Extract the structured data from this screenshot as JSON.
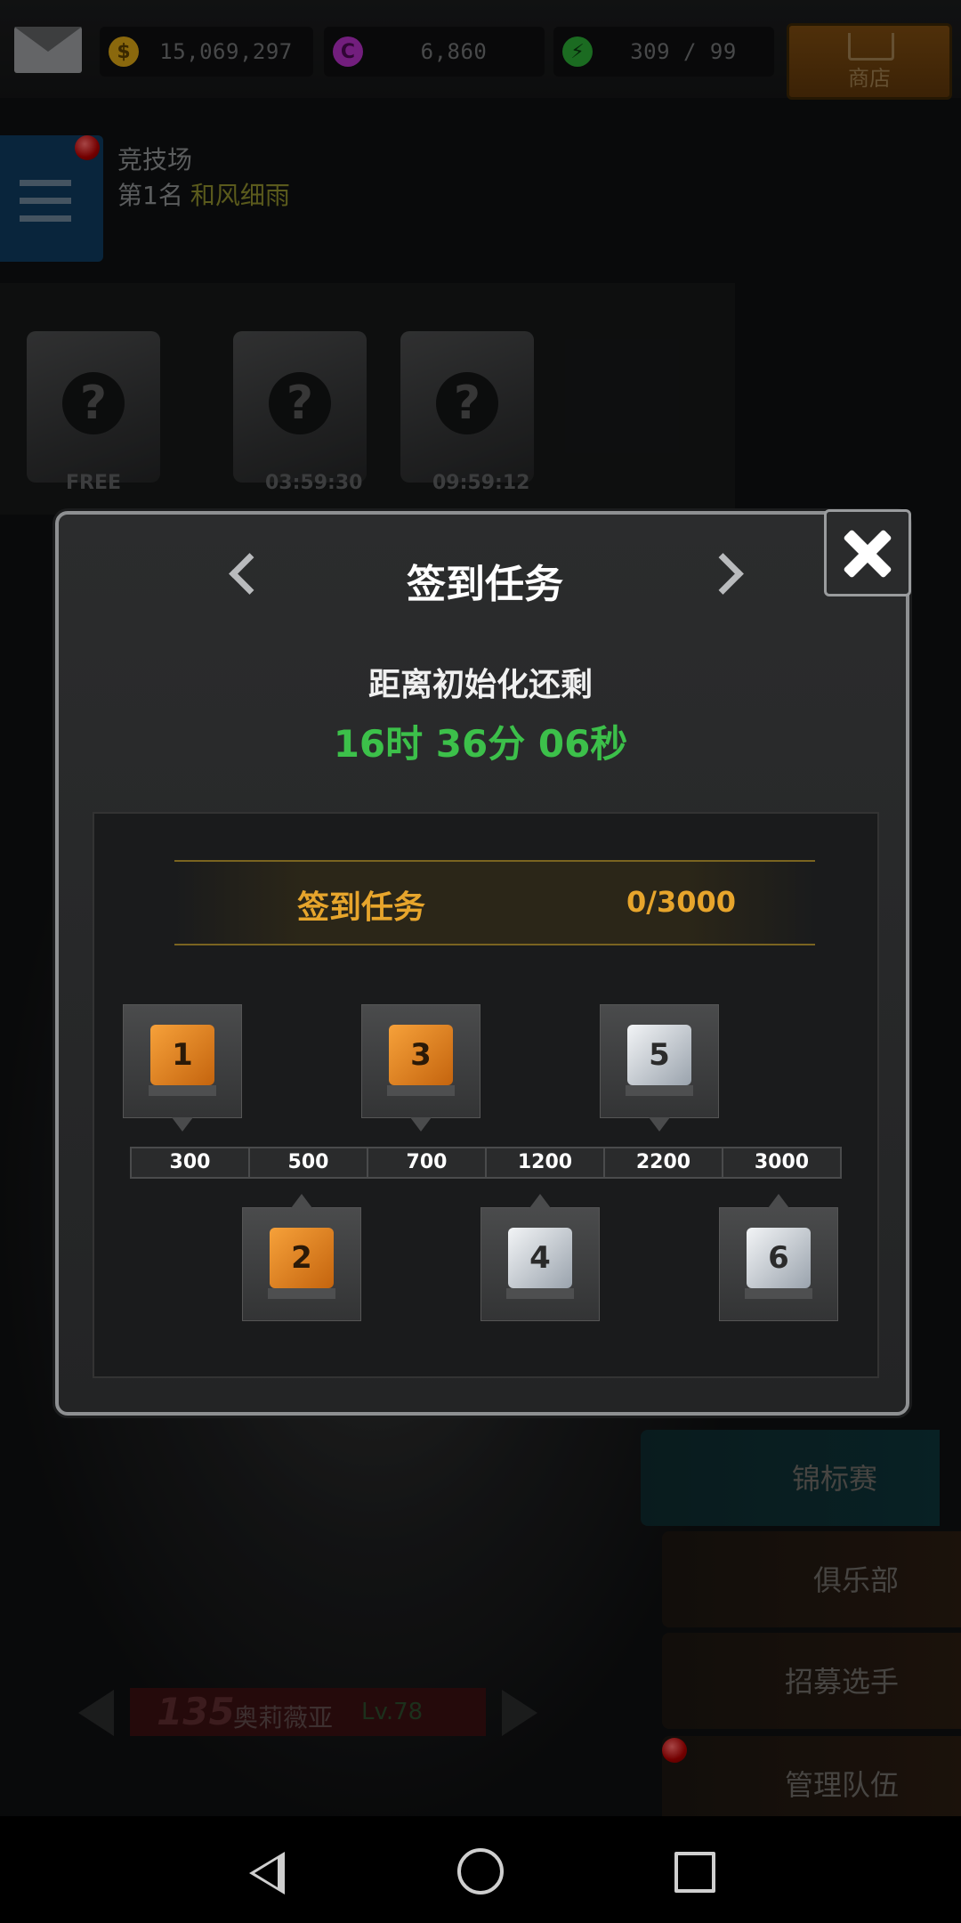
{
  "topbar": {
    "gold": "15,069,297",
    "coins": "6,860",
    "energy": "309 / 99",
    "shop_label": "商店",
    "colors": {
      "gold": "#d4a014",
      "coin": "#b02fc0",
      "energy": "#2aa534"
    }
  },
  "arena": {
    "title": "竞技场",
    "rank_prefix": "第1名",
    "rank_name": "和风细雨"
  },
  "chests": [
    {
      "label": "FREE"
    },
    {
      "label": "03:59:30"
    },
    {
      "label": "09:59:12"
    }
  ],
  "right_menu": [
    {
      "label": "锦标赛"
    },
    {
      "label": "俱乐部"
    },
    {
      "label": "招募选手"
    },
    {
      "label": "管理队伍"
    }
  ],
  "player": {
    "number": "135",
    "name": "奥莉薇亚",
    "level": "Lv.78"
  },
  "dialog": {
    "title": "签到任务",
    "reset_label": "距离初始化还剩",
    "reset_time": "16时 36分 06秒",
    "banner_title": "签到任务",
    "banner_progress": "0/3000",
    "milestones": [
      "300",
      "500",
      "700",
      "1200",
      "2200",
      "3000"
    ],
    "rewards": [
      {
        "rank": "1",
        "tier": "gold"
      },
      {
        "rank": "2",
        "tier": "gold"
      },
      {
        "rank": "3",
        "tier": "gold"
      },
      {
        "rank": "4",
        "tier": "silver"
      },
      {
        "rank": "5",
        "tier": "silver"
      },
      {
        "rank": "6",
        "tier": "silver"
      }
    ],
    "accent": "#e7a52c",
    "time_color": "#3cc04a"
  }
}
